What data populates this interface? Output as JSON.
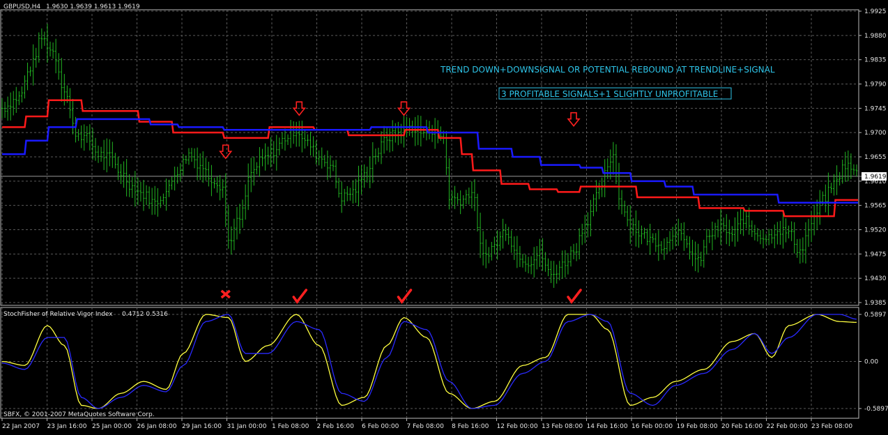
{
  "header": {
    "symbol": "GBPUSD,H4",
    "ohlc": "1.9630 1.9639 1.9613 1.9619"
  },
  "annotations": {
    "line1": "TREND DOWN+DOWNSIGNAL OR POTENTIAL REBOUND AT TRENDLINE+SIGNAL",
    "line2": "3 PROFITABLE SIGNALS+1 SLIGHTLY UNPROFITABLE"
  },
  "price_tag": "1.9619",
  "indicator": {
    "name": "StochFisher of Relative Vigor Index",
    "values": "0.4712 0.5316"
  },
  "copyright": "SBFX, © 2001-2007 MetaQuotes Software Corp.",
  "colors": {
    "background": "#000000",
    "grid": "#5a5a5a",
    "bars": "#22b822",
    "red_line": "#ff1a1a",
    "blue_line": "#1a1aff",
    "signal_yellow": "#ffff40",
    "signal_blue": "#2a2aff",
    "annotation_text": "#2ec4e8",
    "marks": "#ff2020"
  },
  "chart_data": [
    {
      "type": "line",
      "title": "GBPUSD,H4",
      "ylim": [
        1.9385,
        1.9925
      ],
      "y_ticks": [
        "1.9925",
        "1.9880",
        "1.9835",
        "1.9790",
        "1.9745",
        "1.9700",
        "1.9655",
        "1.9610",
        "1.9565",
        "1.9520",
        "1.9475",
        "1.9430",
        "1.9385"
      ],
      "x_tick_labels": [
        "22 Jan 2007",
        "23 Jan 16:00",
        "25 Jan 00:00",
        "26 Jan 08:00",
        "29 Jan 16:00",
        "31 Jan 00:00",
        "1 Feb 08:00",
        "2 Feb 16:00",
        "6 Feb 00:00",
        "7 Feb 08:00",
        "8 Feb 16:00",
        "12 Feb 00:00",
        "13 Feb 08:00",
        "14 Feb 16:00",
        "16 Feb 00:00",
        "19 Feb 08:00",
        "20 Feb 16:00",
        "22 Feb 00:00",
        "23 Feb 08:00"
      ],
      "price_series_anchors": [
        [
          0,
          1.9745
        ],
        [
          6,
          1.9765
        ],
        [
          10,
          1.982
        ],
        [
          14,
          1.9875
        ],
        [
          18,
          1.985
        ],
        [
          22,
          1.978
        ],
        [
          26,
          1.97
        ],
        [
          30,
          1.969
        ],
        [
          34,
          1.966
        ],
        [
          38,
          1.9655
        ],
        [
          42,
          1.9625
        ],
        [
          46,
          1.96
        ],
        [
          50,
          1.9585
        ],
        [
          54,
          1.957
        ],
        [
          58,
          1.959
        ],
        [
          62,
          1.963
        ],
        [
          66,
          1.966
        ],
        [
          70,
          1.964
        ],
        [
          74,
          1.9615
        ],
        [
          78,
          1.96
        ],
        [
          80,
          1.95
        ],
        [
          84,
          1.954
        ],
        [
          88,
          1.9625
        ],
        [
          92,
          1.965
        ],
        [
          96,
          1.9665
        ],
        [
          100,
          1.969
        ],
        [
          104,
          1.9705
        ],
        [
          108,
          1.968
        ],
        [
          112,
          1.9655
        ],
        [
          116,
          1.964
        ],
        [
          120,
          1.958
        ],
        [
          124,
          1.959
        ],
        [
          128,
          1.962
        ],
        [
          132,
          1.966
        ],
        [
          136,
          1.969
        ],
        [
          140,
          1.97
        ],
        [
          144,
          1.971
        ],
        [
          148,
          1.97
        ],
        [
          152,
          1.9705
        ],
        [
          156,
          1.969
        ],
        [
          158,
          1.958
        ],
        [
          162,
          1.9575
        ],
        [
          166,
          1.959
        ],
        [
          170,
          1.947
        ],
        [
          174,
          1.949
        ],
        [
          178,
          1.952
        ],
        [
          182,
          1.9475
        ],
        [
          186,
          1.946
        ],
        [
          190,
          1.9475
        ],
        [
          194,
          1.9435
        ],
        [
          198,
          1.9455
        ],
        [
          202,
          1.948
        ],
        [
          206,
          1.953
        ],
        [
          210,
          1.958
        ],
        [
          214,
          1.963
        ],
        [
          216,
          1.9665
        ],
        [
          218,
          1.958
        ],
        [
          222,
          1.953
        ],
        [
          226,
          1.951
        ],
        [
          230,
          1.95
        ],
        [
          234,
          1.949
        ],
        [
          238,
          1.952
        ],
        [
          242,
          1.949
        ],
        [
          246,
          1.946
        ],
        [
          250,
          1.951
        ],
        [
          254,
          1.9525
        ],
        [
          258,
          1.951
        ],
        [
          262,
          1.954
        ],
        [
          266,
          1.9515
        ],
        [
          270,
          1.9505
        ],
        [
          274,
          1.952
        ],
        [
          278,
          1.9515
        ],
        [
          282,
          1.948
        ],
        [
          286,
          1.953
        ],
        [
          290,
          1.9575
        ],
        [
          294,
          1.9605
        ],
        [
          298,
          1.964
        ],
        [
          302,
          1.9625
        ]
      ],
      "bar_count": 303,
      "series": [
        {
          "steps": [
            [
              0,
              1.971
            ],
            [
              8,
              1.973
            ],
            [
              16,
              1.976
            ],
            [
              28,
              1.974
            ],
            [
              48,
              1.972
            ],
            [
              60,
              1.97
            ],
            [
              78,
              1.969
            ],
            [
              94,
              1.971
            ],
            [
              110,
              1.9705
            ],
            [
              122,
              1.9695
            ],
            [
              142,
              1.9705
            ],
            [
              154,
              1.969
            ],
            [
              162,
              1.966
            ],
            [
              166,
              1.963
            ],
            [
              176,
              1.9605
            ],
            [
              186,
              1.9595
            ],
            [
              196,
              1.959
            ],
            [
              204,
              1.96
            ],
            [
              224,
              1.958
            ],
            [
              234,
              1.958
            ],
            [
              246,
              1.956
            ],
            [
              262,
              1.9555
            ],
            [
              276,
              1.9545
            ],
            [
              294,
              1.9575
            ],
            [
              302,
              1.9575
            ]
          ]
        },
        {
          "steps": [
            [
              0,
              1.966
            ],
            [
              8,
              1.9685
            ],
            [
              16,
              1.971
            ],
            [
              26,
              1.9725
            ],
            [
              38,
              1.9725
            ],
            [
              52,
              1.9715
            ],
            [
              62,
              1.971
            ],
            [
              78,
              1.9705
            ],
            [
              92,
              1.9705
            ],
            [
              108,
              1.9705
            ],
            [
              130,
              1.971
            ],
            [
              150,
              1.97
            ],
            [
              168,
              1.967
            ],
            [
              180,
              1.9655
            ],
            [
              190,
              1.964
            ],
            [
              204,
              1.9635
            ],
            [
              212,
              1.9625
            ],
            [
              222,
              1.961
            ],
            [
              234,
              1.96
            ],
            [
              244,
              1.9585
            ],
            [
              258,
              1.9585
            ],
            [
              274,
              1.957
            ],
            [
              288,
              1.957
            ],
            [
              302,
              1.957
            ]
          ]
        }
      ],
      "signals": [
        {
          "type": "down-arrow",
          "bar": 79,
          "price": 1.966,
          "mark": "cross"
        },
        {
          "type": "down-arrow",
          "bar": 105,
          "price": 1.974,
          "mark": "check"
        },
        {
          "type": "down-arrow",
          "bar": 142,
          "price": 1.974,
          "mark": "check"
        },
        {
          "type": "down-arrow",
          "bar": 202,
          "price": 1.972,
          "mark": "check"
        }
      ]
    },
    {
      "type": "line",
      "title": "StochFisher of Relative Vigor Index",
      "ylim": [
        -0.5897,
        0.5897
      ],
      "y_ticks": [
        "0.5897",
        "0.00",
        "-0.5897"
      ],
      "series": [
        {
          "name": "yellow",
          "anchors": [
            [
              0,
              0.0
            ],
            [
              8,
              -0.05
            ],
            [
              16,
              0.45
            ],
            [
              22,
              0.2
            ],
            [
              28,
              -0.55
            ],
            [
              34,
              -0.59
            ],
            [
              42,
              -0.4
            ],
            [
              50,
              -0.25
            ],
            [
              58,
              -0.35
            ],
            [
              64,
              0.1
            ],
            [
              72,
              0.59
            ],
            [
              80,
              0.55
            ],
            [
              86,
              0.0
            ],
            [
              94,
              0.2
            ],
            [
              104,
              0.59
            ],
            [
              112,
              0.2
            ],
            [
              120,
              -0.55
            ],
            [
              128,
              -0.45
            ],
            [
              136,
              0.2
            ],
            [
              142,
              0.55
            ],
            [
              150,
              0.3
            ],
            [
              158,
              -0.4
            ],
            [
              166,
              -0.59
            ],
            [
              174,
              -0.5
            ],
            [
              184,
              -0.05
            ],
            [
              192,
              0.05
            ],
            [
              200,
              0.59
            ],
            [
              208,
              0.59
            ],
            [
              214,
              0.4
            ],
            [
              222,
              -0.55
            ],
            [
              230,
              -0.45
            ],
            [
              238,
              -0.25
            ],
            [
              248,
              -0.1
            ],
            [
              258,
              0.25
            ],
            [
              266,
              0.35
            ],
            [
              272,
              0.05
            ],
            [
              278,
              0.45
            ],
            [
              288,
              0.59
            ],
            [
              296,
              0.5
            ],
            [
              302,
              0.49
            ]
          ]
        },
        {
          "name": "blue",
          "anchors": [
            [
              0,
              -0.02
            ],
            [
              8,
              -0.1
            ],
            [
              16,
              0.3
            ],
            [
              22,
              0.3
            ],
            [
              28,
              -0.45
            ],
            [
              34,
              -0.59
            ],
            [
              42,
              -0.45
            ],
            [
              50,
              -0.3
            ],
            [
              58,
              -0.38
            ],
            [
              64,
              -0.05
            ],
            [
              72,
              0.5
            ],
            [
              80,
              0.59
            ],
            [
              86,
              0.1
            ],
            [
              94,
              0.1
            ],
            [
              104,
              0.5
            ],
            [
              112,
              0.4
            ],
            [
              120,
              -0.4
            ],
            [
              128,
              -0.5
            ],
            [
              136,
              0.05
            ],
            [
              142,
              0.5
            ],
            [
              150,
              0.4
            ],
            [
              158,
              -0.25
            ],
            [
              166,
              -0.59
            ],
            [
              174,
              -0.55
            ],
            [
              184,
              -0.15
            ],
            [
              192,
              0.0
            ],
            [
              200,
              0.5
            ],
            [
              208,
              0.59
            ],
            [
              214,
              0.5
            ],
            [
              222,
              -0.4
            ],
            [
              230,
              -0.55
            ],
            [
              238,
              -0.3
            ],
            [
              248,
              -0.15
            ],
            [
              258,
              0.15
            ],
            [
              266,
              0.35
            ],
            [
              272,
              0.1
            ],
            [
              278,
              0.3
            ],
            [
              288,
              0.59
            ],
            [
              296,
              0.59
            ],
            [
              302,
              0.53
            ]
          ]
        }
      ]
    }
  ]
}
